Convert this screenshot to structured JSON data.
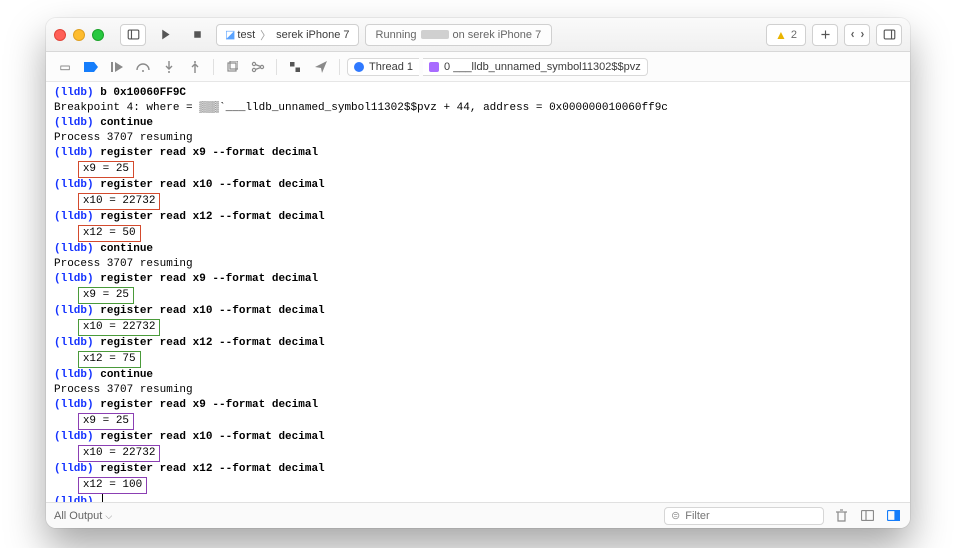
{
  "titlebar": {
    "scheme": "test",
    "device": "serek iPhone 7",
    "status_prefix": "Running",
    "status_suffix": "on serek iPhone 7",
    "warning_count": "2"
  },
  "subbar": {
    "thread": "Thread 1",
    "frame": "0  ___lldb_unnamed_symbol11302$$pvz"
  },
  "console": {
    "prompt": "(lldb)",
    "lines": [
      {
        "t": "cmd",
        "text": "b 0x10060FF9C"
      },
      {
        "t": "out",
        "text": "Breakpoint 4: where = ▒▒▒`___lldb_unnamed_symbol11302$$pvz + 44, address = 0x000000010060ff9c"
      },
      {
        "t": "cmd",
        "text": "continue"
      },
      {
        "t": "out",
        "text": "Process 3707 resuming"
      },
      {
        "t": "cmd",
        "text": "register read x9 --format decimal"
      },
      {
        "t": "box",
        "cls": "red",
        "text": "x9 = 25"
      },
      {
        "t": "cmd",
        "text": "register read x10 --format decimal"
      },
      {
        "t": "box",
        "cls": "red",
        "text": "x10 = 22732"
      },
      {
        "t": "cmd",
        "text": "register read x12 --format decimal"
      },
      {
        "t": "box",
        "cls": "red",
        "text": "x12 = 50"
      },
      {
        "t": "cmd",
        "text": "continue"
      },
      {
        "t": "out",
        "text": "Process 3707 resuming"
      },
      {
        "t": "cmd",
        "text": "register read x9 --format decimal"
      },
      {
        "t": "box",
        "cls": "green",
        "text": "x9 = 25"
      },
      {
        "t": "cmd",
        "text": "register read x10 --format decimal"
      },
      {
        "t": "box",
        "cls": "green",
        "text": "x10 = 22732"
      },
      {
        "t": "cmd",
        "text": "register read x12 --format decimal"
      },
      {
        "t": "box",
        "cls": "green",
        "text": "x12 = 75"
      },
      {
        "t": "cmd",
        "text": "continue"
      },
      {
        "t": "out",
        "text": "Process 3707 resuming"
      },
      {
        "t": "cmd",
        "text": "register read x9 --format decimal"
      },
      {
        "t": "box",
        "cls": "purple",
        "text": "x9 = 25"
      },
      {
        "t": "cmd",
        "text": "register read x10 --format decimal"
      },
      {
        "t": "box",
        "cls": "purple",
        "text": "x10 = 22732"
      },
      {
        "t": "cmd",
        "text": "register read x12 --format decimal"
      },
      {
        "t": "box",
        "cls": "purple",
        "text": "x12 = 100"
      },
      {
        "t": "empty-cmd"
      }
    ]
  },
  "bottombar": {
    "output_scope": "All Output",
    "filter_placeholder": "Filter"
  }
}
